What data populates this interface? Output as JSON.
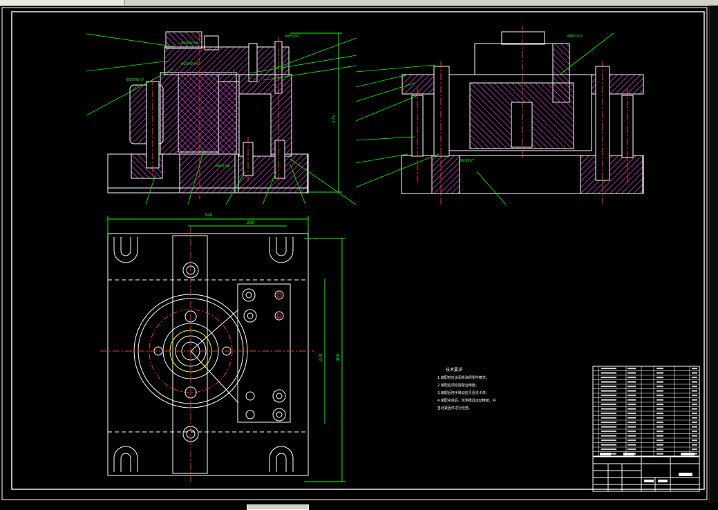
{
  "window": {
    "background": "#000000",
    "line_color": "#ffffff",
    "hatch_color": "#c040c0",
    "dim_color": "#00ff00",
    "center_color": "#ff3030",
    "accent_yellow": "#ffff00"
  },
  "front_view": {
    "fits": [
      "Φ25H7/n6",
      "Φ25H7/n6",
      "Φ25H8/n7",
      "Φ8H7/h6",
      "Φ8H7/h7"
    ],
    "height_dim": "275"
  },
  "side_view": {
    "fits": [
      "Φ8H7/h7",
      "Φ6H8/h7"
    ]
  },
  "top_view": {
    "width_outer": "340",
    "width_inner": "280",
    "height_outer": "400",
    "height_inner": "270"
  },
  "tech_notes": {
    "title": "技术要求",
    "lines": [
      "1.装配时应涂润滑油把零件擦洗；",
      "2.装配后须检验配合精度；",
      "3.装配后用手转动应灵活无卡滞；",
      "4.装配完成后，检测模具运动精度，并",
      "各处紧固件进行检查。"
    ]
  },
  "icons": {
    "scroll": "scrollbar-thumb-icon"
  }
}
